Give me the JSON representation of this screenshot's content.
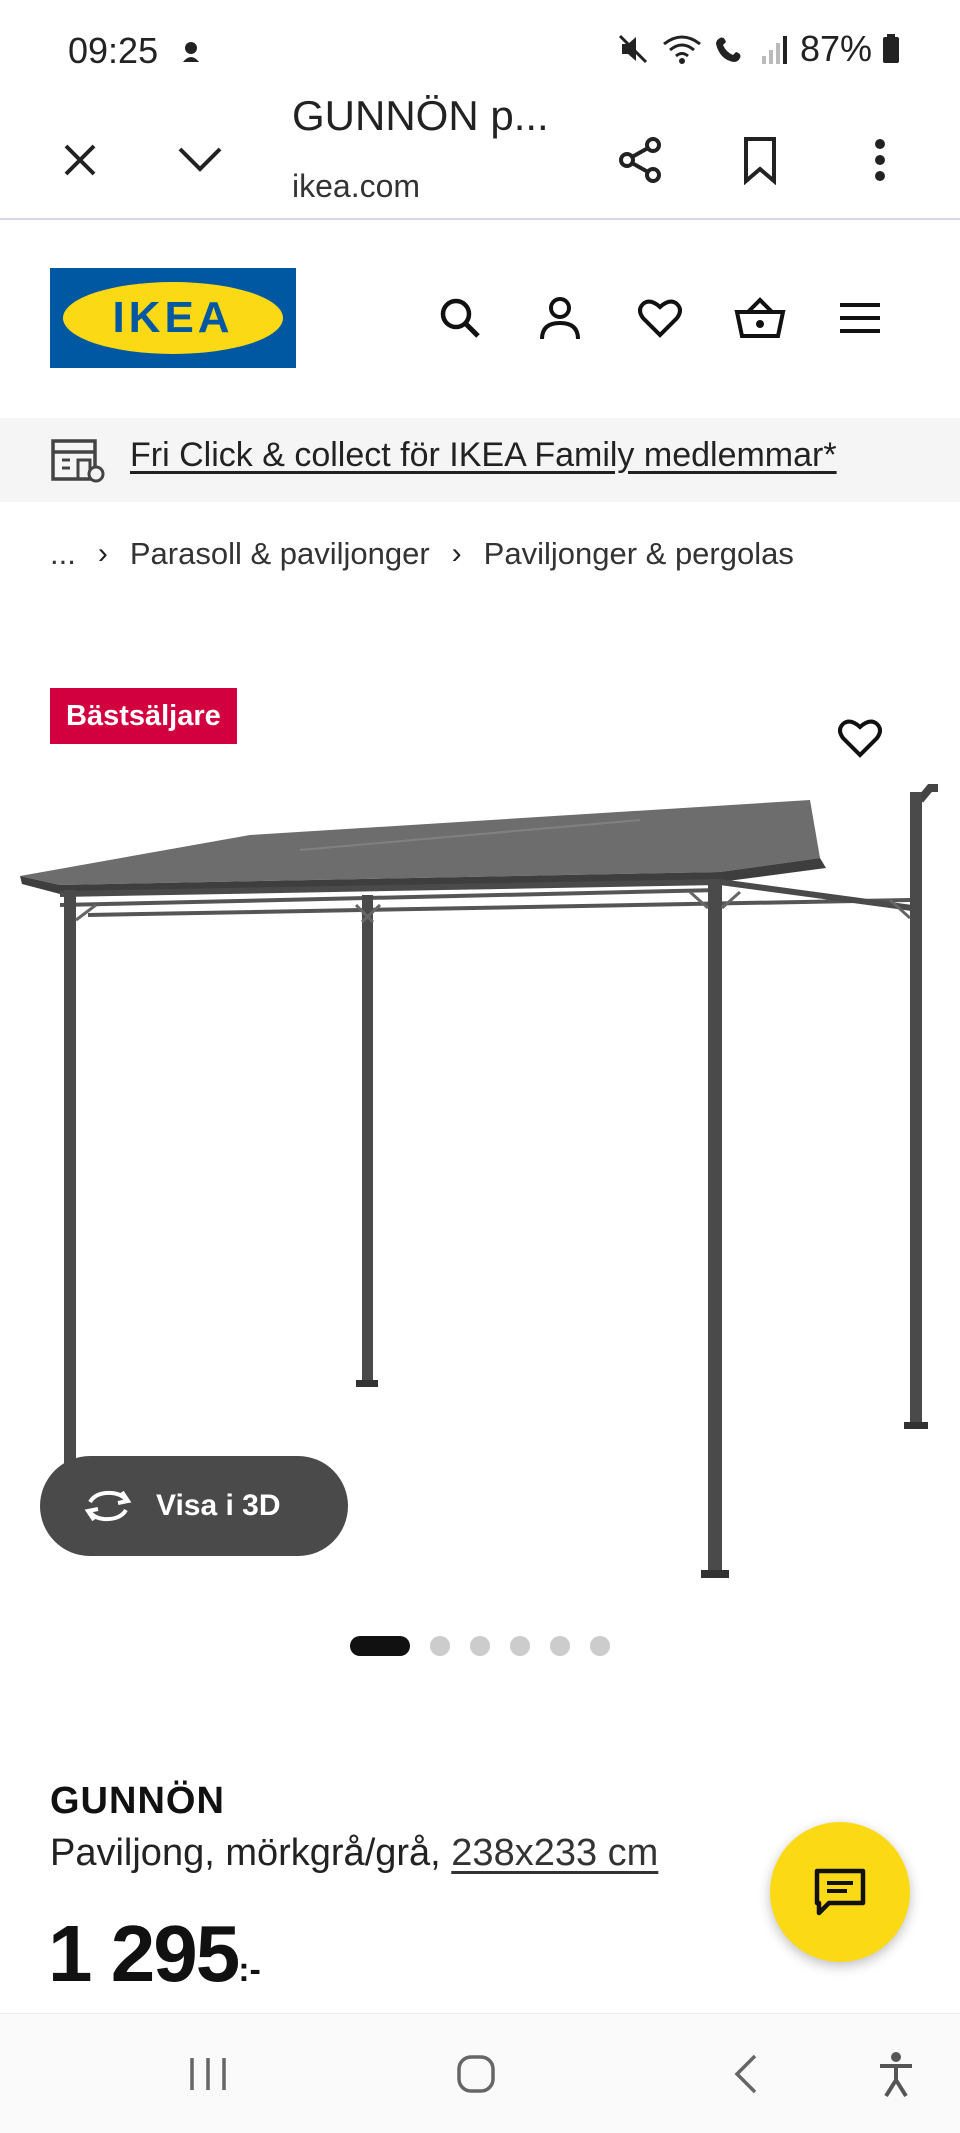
{
  "status_bar": {
    "time": "09:25",
    "battery": "87%"
  },
  "browser": {
    "title": "GUNNÖN p...",
    "url": "ikea.com"
  },
  "header": {
    "logo_text": "IKEA"
  },
  "promo": {
    "text": "Fri Click & collect för IKEA Family medlemmar*"
  },
  "breadcrumb": {
    "items": [
      "...",
      "Parasoll & paviljonger",
      "Paviljonger & pergolas"
    ]
  },
  "gallery": {
    "badge": "Bästsäljare",
    "view3d_label": "Visa i 3D",
    "image_count": 6,
    "active_index": 0
  },
  "product": {
    "name": "GUNNÖN",
    "description": "Paviljong, mörkgrå/grå, ",
    "size": "238x233 cm",
    "price": "1 295",
    "price_suffix": ":-"
  },
  "colors": {
    "ikea_blue": "#0058a3",
    "ikea_yellow": "#fbd914",
    "badge_red": "#d3003f"
  },
  "icons": {
    "browser": [
      "close-icon",
      "chevron-down-icon",
      "share-icon",
      "bookmark-icon",
      "more-vert-icon"
    ],
    "header": [
      "search-icon",
      "user-icon",
      "heart-icon",
      "basket-icon",
      "menu-icon"
    ]
  }
}
